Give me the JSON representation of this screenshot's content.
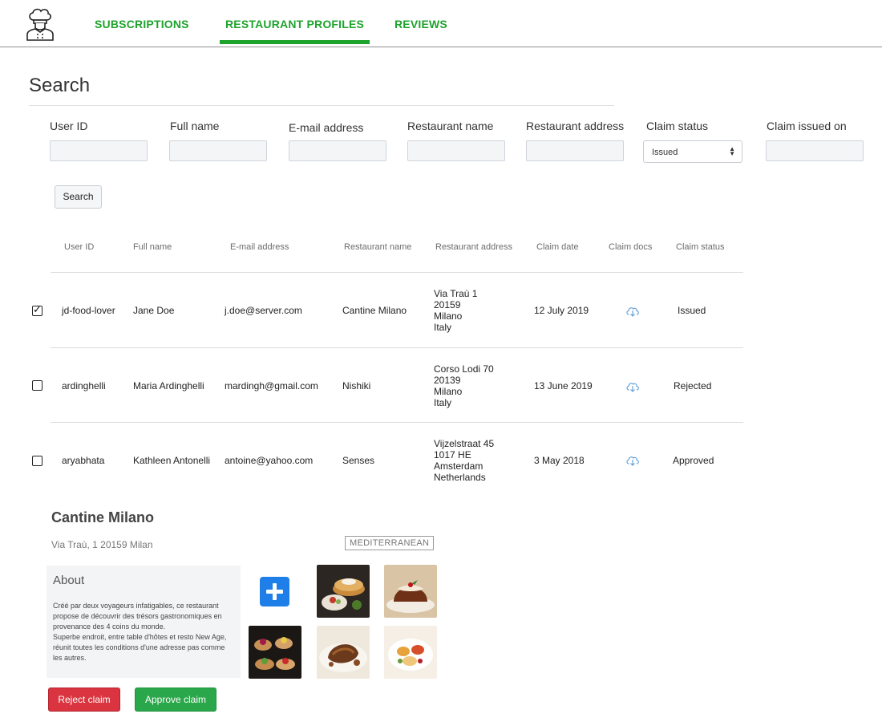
{
  "nav": {
    "tabs": [
      {
        "label": "SUBSCRIPTIONS",
        "active": false
      },
      {
        "label": "RESTAURANT PROFILES",
        "active": true
      },
      {
        "label": "REVIEWS",
        "active": false
      }
    ],
    "accent_color": "#1ea32c"
  },
  "search": {
    "title": "Search",
    "filters": {
      "user_id": {
        "label": "User ID",
        "value": ""
      },
      "full_name": {
        "label": "Full name",
        "value": ""
      },
      "email": {
        "label": "E-mail address",
        "value": ""
      },
      "restaurant_name": {
        "label": "Restaurant name",
        "value": ""
      },
      "restaurant_address": {
        "label": "Restaurant address",
        "value": ""
      },
      "claim_status": {
        "label": "Claim status",
        "selected": "Issued"
      },
      "claim_issued_on": {
        "label": "Claim issued on",
        "value": ""
      }
    },
    "button_label": "Search"
  },
  "table": {
    "columns": [
      "User ID",
      "Full name",
      "E-mail address",
      "Restaurant name",
      "Restaurant address",
      "Claim date",
      "Claim docs",
      "Claim status"
    ],
    "rows": [
      {
        "checked": true,
        "user_id": "jd-food-lover",
        "full_name": "Jane Doe",
        "email": "j.doe@server.com",
        "restaurant_name": "Cantine Milano",
        "address_lines": [
          "Via Traù 1",
          "20159",
          "Milano",
          "Italy"
        ],
        "claim_date": "12 July 2019",
        "claim_docs_icon": "cloud-download-icon",
        "claim_status": "Issued"
      },
      {
        "checked": false,
        "user_id": "ardinghelli",
        "full_name": "Maria Ardinghelli",
        "email": "mardingh@gmail.com",
        "restaurant_name": "Nishiki",
        "address_lines": [
          "Corso Lodi 70",
          "20139",
          "Milano",
          "Italy"
        ],
        "claim_date": "13 June 2019",
        "claim_docs_icon": "cloud-download-icon",
        "claim_status": "Rejected"
      },
      {
        "checked": false,
        "user_id": "aryabhata",
        "full_name": "Kathleen Antonelli",
        "email": "antoine@yahoo.com",
        "restaurant_name": "Senses",
        "address_lines": [
          "Vijzelstraat 45",
          "1017 HE",
          "Amsterdam",
          "Netherlands"
        ],
        "claim_date": "3 May 2018",
        "claim_docs_icon": "cloud-download-icon",
        "claim_status": "Approved"
      }
    ]
  },
  "detail": {
    "restaurant_name": "Cantine Milano",
    "address": "Via Traù, 1 20159 Milan",
    "cuisine_tag": "MEDITERRANEAN",
    "about_title": "About",
    "about_text": "Créé par deux voyageurs infatigables, ce restaurant propose de découvrir des trésors gastronomiques en provenance des 4 coins du monde.\nSuperbe endroit, entre table d'hôtes et resto New Age, réunit toutes les conditions d'une adresse pas comme les autres.",
    "photos": [
      "pancakes-photo",
      "pudding-photo",
      "canapes-photo",
      "roast-photo",
      "dessert-photo"
    ],
    "reject_label": "Reject claim",
    "approve_label": "Approve claim",
    "reject_color": "#d9343f",
    "approve_color": "#2aa74a"
  }
}
